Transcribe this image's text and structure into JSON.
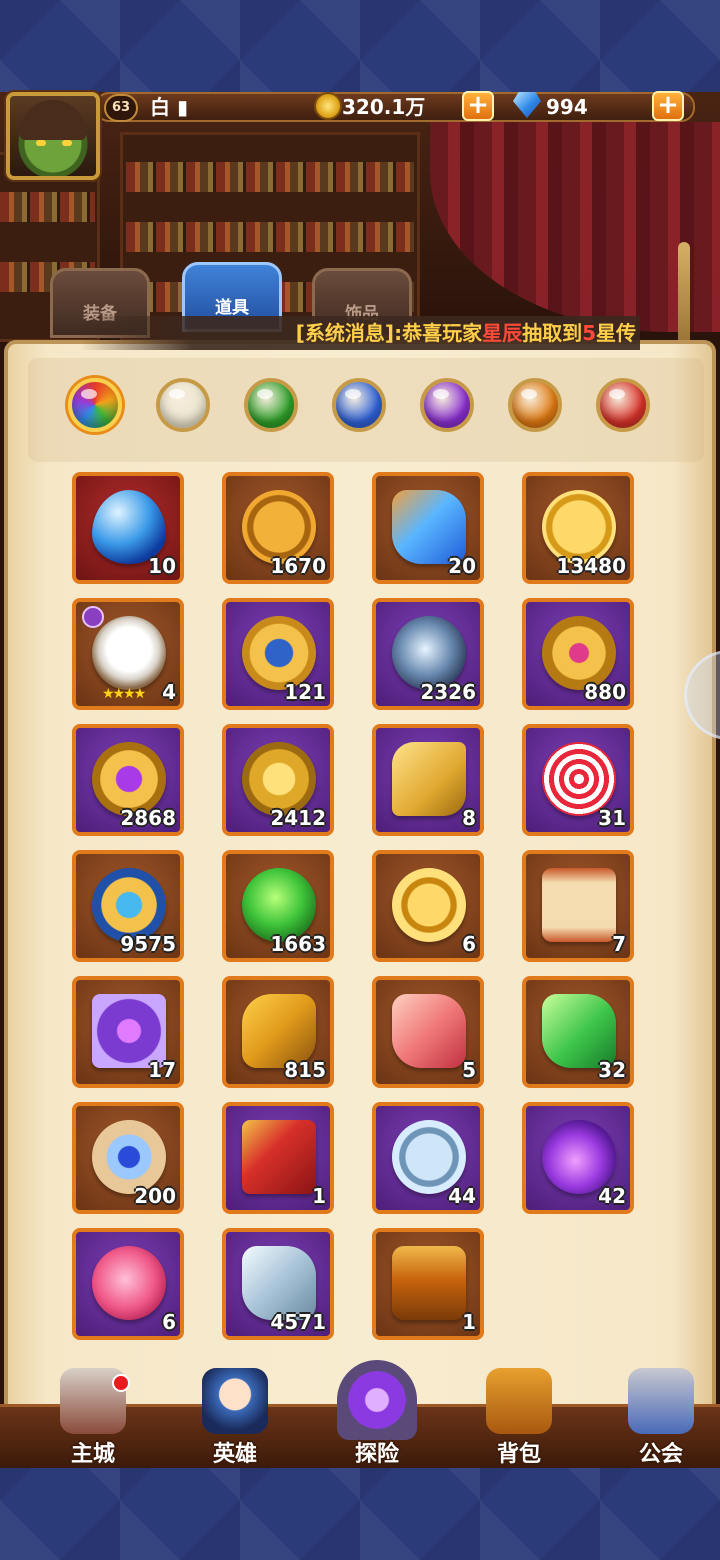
{
  "header": {
    "level": "63",
    "player_name": "白 ▮",
    "gold": "320.1万",
    "diamonds": "994",
    "plus_label": "+"
  },
  "tabs": [
    {
      "label": "装备",
      "active": false
    },
    {
      "label": "道具",
      "active": true
    },
    {
      "label": "饰品",
      "active": false
    }
  ],
  "notice": {
    "prefix": "[系统消息]:恭喜玩家",
    "player": "星辰",
    "middle": "抽取到",
    "number": "5",
    "suffix": "星传"
  },
  "filters": [
    {
      "name": "all",
      "color": "rainbow",
      "selected": true
    },
    {
      "name": "white",
      "color": "#ece6cf"
    },
    {
      "name": "green",
      "color": "#2fa12a"
    },
    {
      "name": "blue",
      "color": "#2f62d8"
    },
    {
      "name": "purple",
      "color": "#8a2fd0"
    },
    {
      "name": "orange",
      "color": "#e07a12"
    },
    {
      "name": "red",
      "color": "#d8332a"
    }
  ],
  "items": [
    {
      "icon": "blue-crystal-icon",
      "count": "10",
      "bg": "red"
    },
    {
      "icon": "skull-coin-icon",
      "count": "1670",
      "bg": "brown"
    },
    {
      "icon": "blue-shard-icon",
      "count": "20",
      "bg": "brown"
    },
    {
      "icon": "gold-face-coin-icon",
      "count": "13480",
      "bg": "brown"
    },
    {
      "icon": "sheep-pet-icon",
      "count": "4",
      "bg": "brown",
      "stars": "★★★★"
    },
    {
      "icon": "sun-badge-icon",
      "count": "121",
      "bg": "purple"
    },
    {
      "icon": "lightning-stone-icon",
      "count": "2326",
      "bg": "purple"
    },
    {
      "icon": "winged-emblem-icon",
      "count": "880",
      "bg": "purple"
    },
    {
      "icon": "purple-gem-shield-icon",
      "count": "2868",
      "bg": "purple"
    },
    {
      "icon": "gold-shield-icon",
      "count": "2412",
      "bg": "purple"
    },
    {
      "icon": "puzzle-piece-icon",
      "count": "8",
      "bg": "purple"
    },
    {
      "icon": "lollipop-icon",
      "count": "31",
      "bg": "purple"
    },
    {
      "icon": "winged-crest-icon",
      "count": "9575",
      "bg": "brown"
    },
    {
      "icon": "green-rune-stone-icon",
      "count": "1663",
      "bg": "brown"
    },
    {
      "icon": "gold-medal-icon",
      "count": "6",
      "bg": "brown"
    },
    {
      "icon": "red-scroll-icon",
      "count": "7",
      "bg": "brown"
    },
    {
      "icon": "purple-card-icon",
      "count": "17",
      "bg": "brown"
    },
    {
      "icon": "gold-rune-icon",
      "count": "815",
      "bg": "brown"
    },
    {
      "icon": "pink-crystal-icon",
      "count": "5",
      "bg": "brown"
    },
    {
      "icon": "green-leaf-crystal-icon",
      "count": "32",
      "bg": "brown"
    },
    {
      "icon": "swirl-scroll-icon",
      "count": "200",
      "bg": "brown"
    },
    {
      "icon": "red-card-icon",
      "count": "1",
      "bg": "purple"
    },
    {
      "icon": "silver-coin-icon",
      "count": "44",
      "bg": "purple"
    },
    {
      "icon": "purple-flame-orb-icon",
      "count": "42",
      "bg": "purple"
    },
    {
      "icon": "winged-heart-icon",
      "count": "6",
      "bg": "purple"
    },
    {
      "icon": "silver-stone-icon",
      "count": "4571",
      "bg": "purple"
    },
    {
      "icon": "treasure-chest-icon",
      "count": "1",
      "bg": "brown"
    }
  ],
  "nav": [
    {
      "label": "主城",
      "icon": "castle-icon"
    },
    {
      "label": "英雄",
      "icon": "hero-icon"
    },
    {
      "label": "探险",
      "icon": "portal-icon"
    },
    {
      "label": "背包",
      "icon": "backpack-icon"
    },
    {
      "label": "公会",
      "icon": "guild-icon"
    }
  ]
}
